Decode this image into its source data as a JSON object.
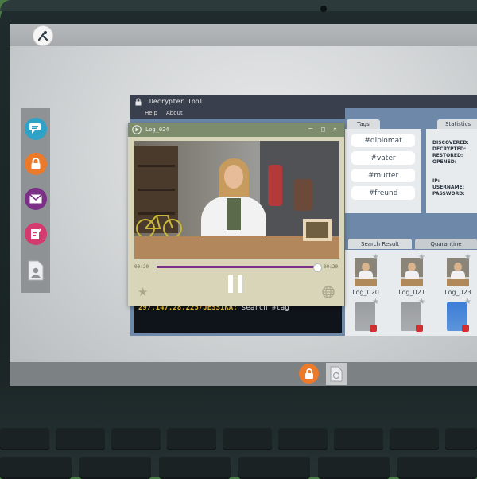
{
  "decrypter": {
    "title": "Decrypter Tool",
    "menu": [
      "Help",
      "About"
    ],
    "terminal": {
      "prompt": "297.147.28.225/JESSIKA:",
      "command": " search #tag"
    }
  },
  "video_player": {
    "title": "Log_024",
    "time_elapsed": "00:20",
    "time_total": "00:20",
    "progress": 1.0
  },
  "tags_panel": {
    "tab": "Tags",
    "tags": [
      "#diplomat",
      "#vater",
      "#mutter",
      "#freund"
    ]
  },
  "statistics_panel": {
    "tab": "Statistics",
    "labels": [
      "DISCOVERED:",
      "DECRYPTED:",
      "RESTORED:",
      "OPENED:",
      "IP:",
      "USERNAME:",
      "PASSWORD:"
    ]
  },
  "results": {
    "tabs": [
      "Search Result",
      "Quarantine"
    ],
    "logs": [
      "Log_020",
      "Log_021",
      "Log_023"
    ],
    "locked_files": [
      {
        "color": "#9a9d9f"
      },
      {
        "color": "#9a9d9f"
      },
      {
        "color": "#3b7ed8"
      }
    ]
  },
  "colors": {
    "accent_orange": "#ec7a2b",
    "accent_purple": "#7b2f86",
    "accent_pink": "#d43a6e",
    "chat_blue": "#2fa3c7",
    "title_green": "#7c8c6c"
  }
}
